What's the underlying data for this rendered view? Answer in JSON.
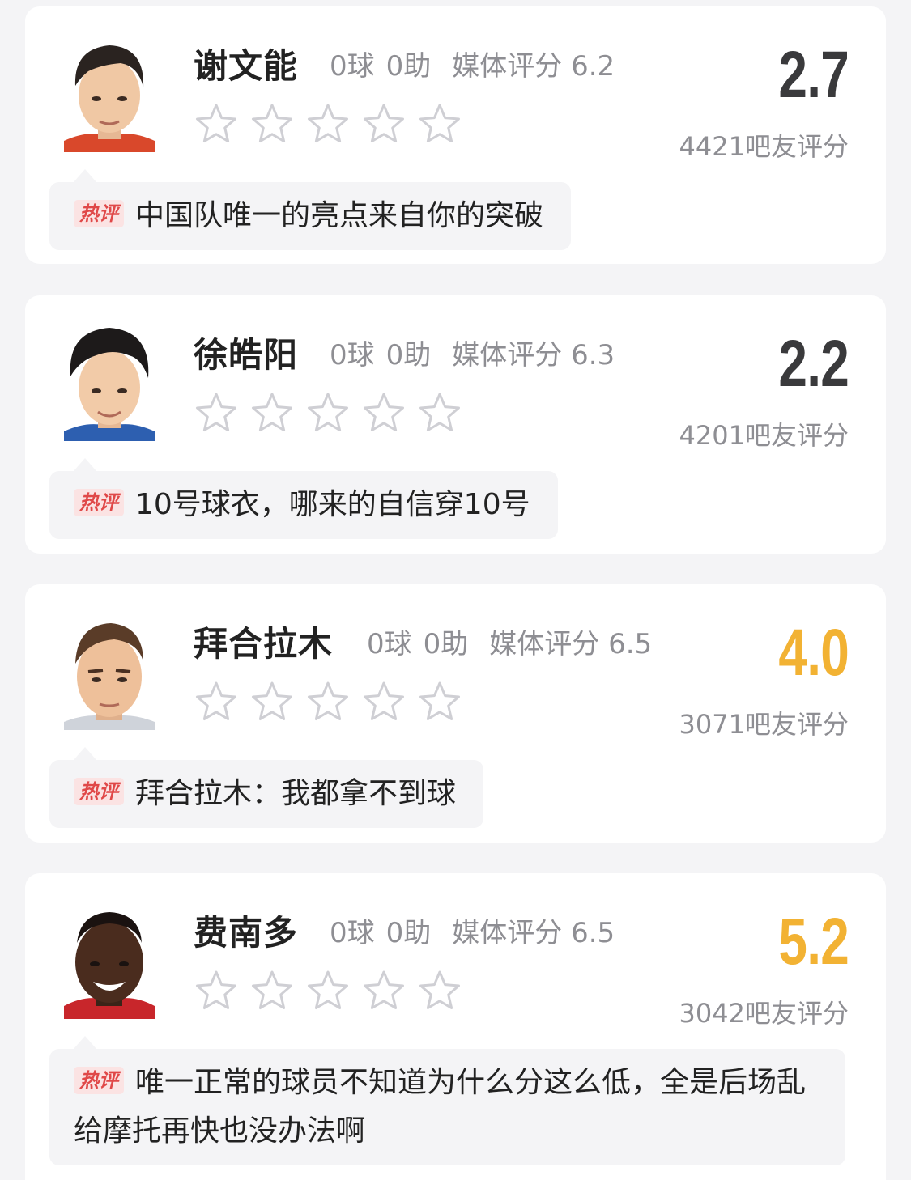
{
  "labels": {
    "hot_comment_badge": "热评"
  },
  "colors": {
    "score_low": "#3a3a3c",
    "score_mid": "#f2b233",
    "badge_bg": "#fbe3e3",
    "badge_text": "#e04848",
    "star_outline": "#cfcfd4"
  },
  "players": [
    {
      "name": "谢文能",
      "goals": "0球",
      "assists": "0助",
      "media_rating": "媒体评分 6.2",
      "fan_score": "2.7",
      "score_tone": "low",
      "raters": "4421吧友评分",
      "star_rating": 0,
      "hot_comment": "中国队唯一的亮点来自你的突破"
    },
    {
      "name": "徐皓阳",
      "goals": "0球",
      "assists": "0助",
      "media_rating": "媒体评分 6.3",
      "fan_score": "2.2",
      "score_tone": "low",
      "raters": "4201吧友评分",
      "star_rating": 0,
      "hot_comment": "10号球衣，哪来的自信穿10号"
    },
    {
      "name": "拜合拉木",
      "goals": "0球",
      "assists": "0助",
      "media_rating": "媒体评分 6.5",
      "fan_score": "4.0",
      "score_tone": "mid",
      "raters": "3071吧友评分",
      "star_rating": 0,
      "hot_comment": "拜合拉木：我都拿不到球"
    },
    {
      "name": "费南多",
      "goals": "0球",
      "assists": "0助",
      "media_rating": "媒体评分 6.5",
      "fan_score": "5.2",
      "score_tone": "mid",
      "raters": "3042吧友评分",
      "star_rating": 0,
      "hot_comment": "唯一正常的球员不知道为什么分这么低，全是后场乱给摩托再快也没办法啊"
    }
  ]
}
